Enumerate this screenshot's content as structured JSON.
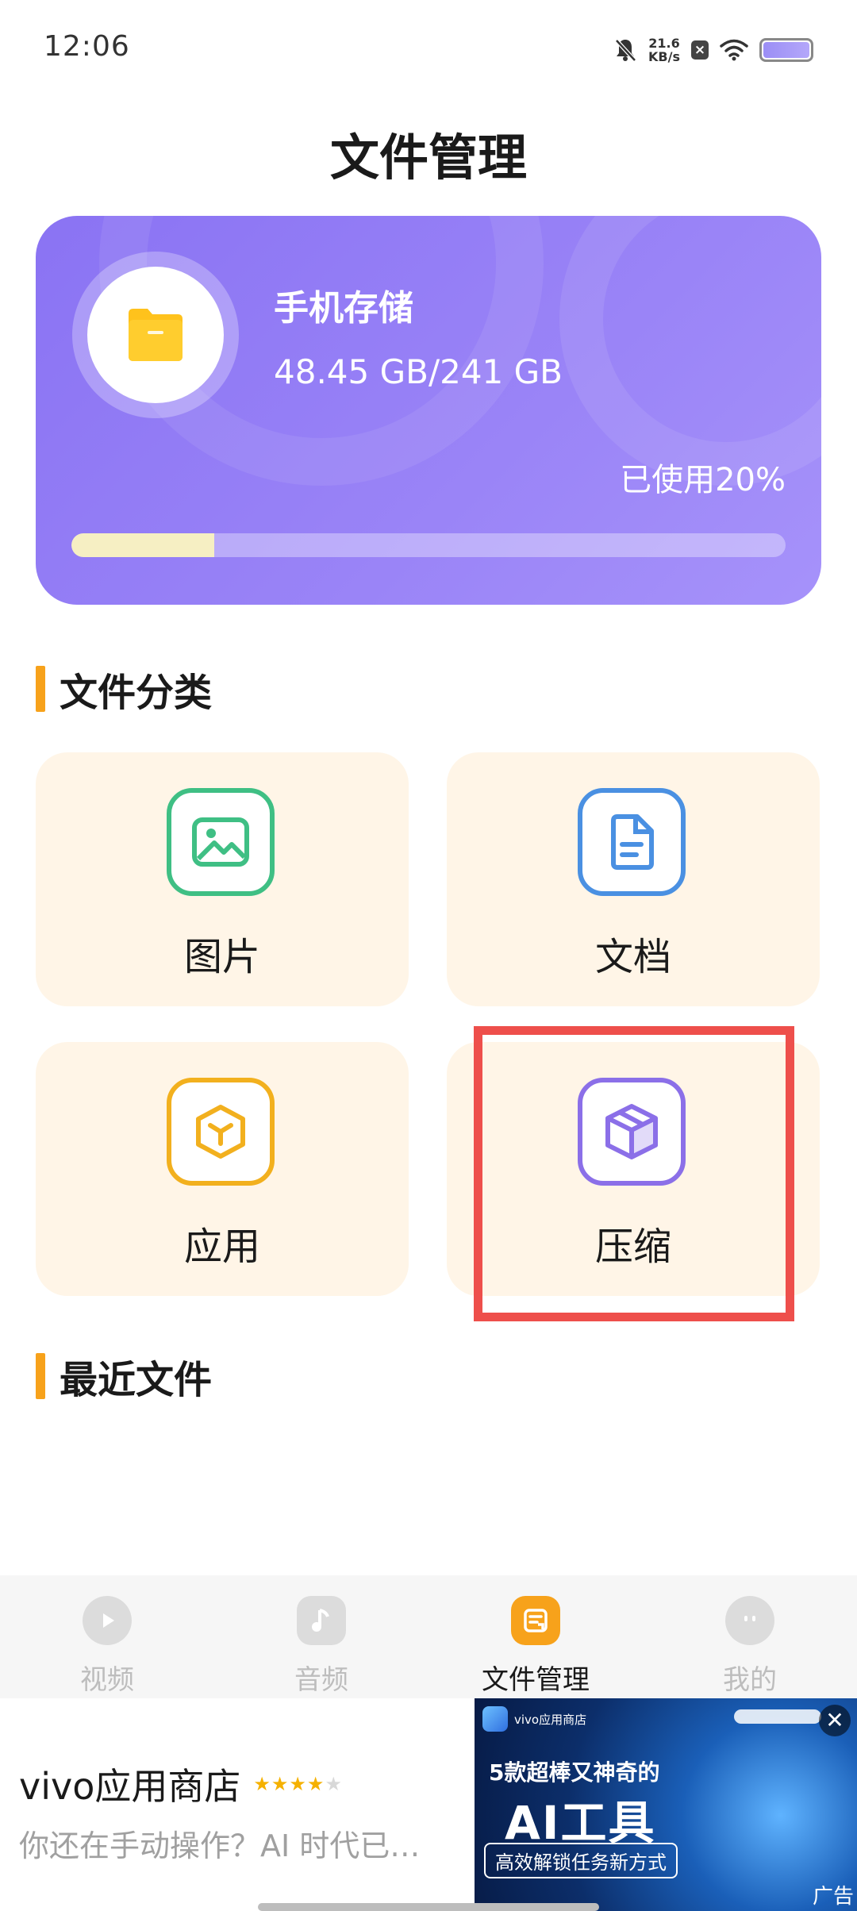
{
  "status_bar": {
    "time": "12:06",
    "net_speed_value": "21.6",
    "net_speed_unit": "KB/s",
    "icons": [
      "mute-icon",
      "network-speed",
      "no-sim-icon",
      "wifi-icon",
      "battery-icon"
    ]
  },
  "page": {
    "title": "文件管理"
  },
  "storage": {
    "name": "手机存储",
    "size_text": "48.45 GB/241 GB",
    "used_text": "已使用20%",
    "used_fraction": 0.2,
    "icon": "folder-icon"
  },
  "categories_section": {
    "title": "文件分类"
  },
  "categories": [
    {
      "label": "图片",
      "icon": "image-icon",
      "color": "#3fbf84"
    },
    {
      "label": "文档",
      "icon": "document-icon",
      "color": "#4a90e2"
    },
    {
      "label": "应用",
      "icon": "app-cube-icon",
      "color": "#f2b01e"
    },
    {
      "label": "压缩",
      "icon": "package-box-icon",
      "color": "#8b6fe8"
    }
  ],
  "recent_section": {
    "title": "最近文件"
  },
  "bottom_nav": [
    {
      "label": "视频",
      "icon": "play-icon",
      "active": false
    },
    {
      "label": "音频",
      "icon": "music-note-icon",
      "active": false
    },
    {
      "label": "文件管理",
      "icon": "file-manager-icon",
      "active": true
    },
    {
      "label": "我的",
      "icon": "profile-face-icon",
      "active": false
    }
  ],
  "ad": {
    "title": "vivo应用商店",
    "rating_stars": 4,
    "rating_max": 5,
    "description": "你还在手动操作？AI 时代已…",
    "banner_store": "vivo应用商店",
    "banner_line1": "5款超棒又神奇的",
    "banner_line2": "AI工具",
    "banner_line3": "高效解锁任务新方式",
    "ad_tag": "广告",
    "close_symbol": "✕"
  },
  "colors": {
    "accent": "#f7a21b",
    "card_purple": "#9a84f7",
    "card_bg": "#fff5e7",
    "highlight_red": "#ee4f4b"
  }
}
